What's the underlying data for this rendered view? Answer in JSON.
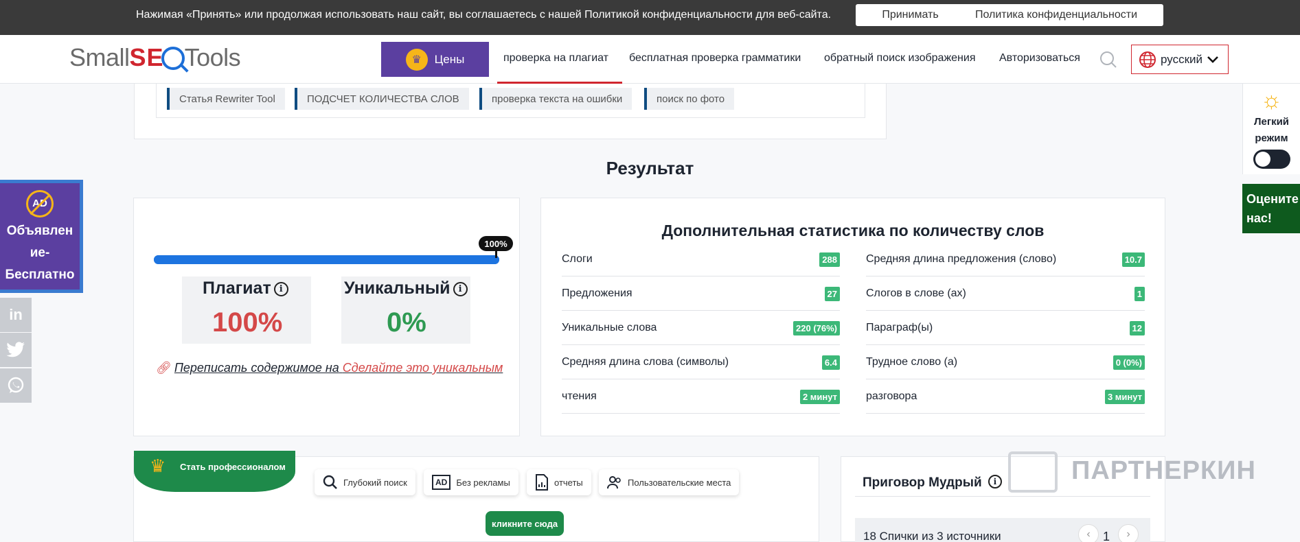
{
  "cookie": {
    "text": "Нажимая «Принять» или продолжая использовать наш сайт, вы соглашаетесь с нашей Политикой конфиденциальности для веб-сайта.",
    "accept": "Принимать",
    "policy": "Политика конфиденциальности"
  },
  "header": {
    "logo_small": "Small",
    "logo_seo": "SE",
    "logo_tools": "Tools",
    "pricing": "Цены",
    "nav": [
      "проверка на плагиат",
      "бесплатная проверка грамматики",
      "обратный поиск изображения",
      "Авторизоваться"
    ],
    "language": "русский"
  },
  "tools": [
    "Статья Rewriter Tool",
    "ПОДСЧЕТ КОЛИЧЕСТВА СЛОВ",
    "проверка текста на ошибки",
    "поиск по фото"
  ],
  "result": {
    "title": "Результат",
    "progress_label": "100%",
    "progress_fraction": 1.0,
    "plagiarism_label": "Плагиат",
    "plagiarism_value": "100%",
    "unique_label": "Уникальный",
    "unique_value": "0%",
    "rewrite_prefix": "Переписать содержимое на",
    "rewrite_link": "Сделайте это уникальным"
  },
  "stats": {
    "title": "Дополнительная статистика по количеству слов",
    "left": [
      {
        "label": "Слоги",
        "value": "288"
      },
      {
        "label": "Предложения",
        "value": "27"
      },
      {
        "label": "Уникальные слова",
        "value": "220 (76%)"
      },
      {
        "label": "Средняя длина слова (символы)",
        "value": "6.4"
      },
      {
        "label": "чтения",
        "value": "2 минут"
      }
    ],
    "right": [
      {
        "label": "Средняя длина предложения (слово)",
        "value": "10.7"
      },
      {
        "label": "Слогов в слове (ах)",
        "value": "1"
      },
      {
        "label": "Параграф(ы)",
        "value": "12"
      },
      {
        "label": "Трудное слово (а)",
        "value": "0 (0%)"
      },
      {
        "label": "разговора",
        "value": "3 минут"
      }
    ]
  },
  "ad": {
    "icon": "AD",
    "text": "Объявлен ие- Бесплатно"
  },
  "social": [
    "in",
    "twitter",
    "whatsapp"
  ],
  "theme": {
    "label": "Легкий режим"
  },
  "rate": {
    "label": "Оцените нас!"
  },
  "pro": {
    "banner": "Стать профессионалом",
    "features": [
      "Глубокий поиск",
      "Без рекламы",
      "отчеты",
      "Пользовательские места"
    ],
    "button": "кликните сюда"
  },
  "verdict": {
    "title": "Приговор Мудрый",
    "text": "18 Спички из 3 источники",
    "page": "1"
  },
  "watermark": "ПАРТНЕРКИН",
  "colors": {
    "accent_red": "#d0262f",
    "purple": "#5b3fa0",
    "green": "#3cb878",
    "blue": "#1d74e0"
  }
}
